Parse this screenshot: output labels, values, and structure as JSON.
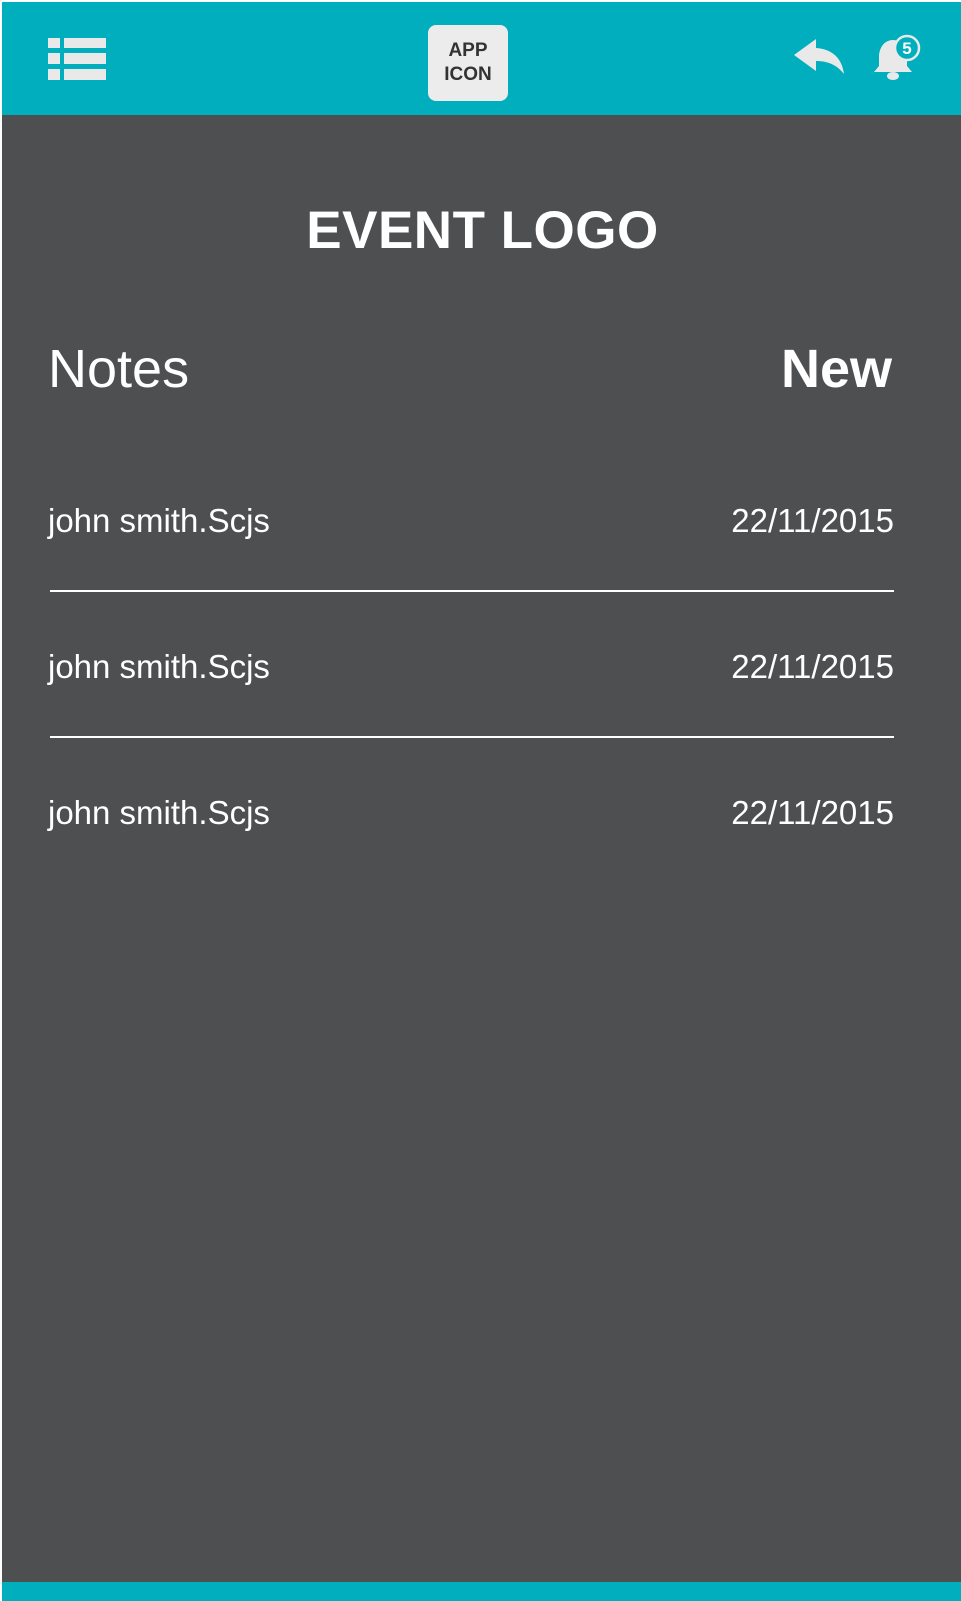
{
  "header": {
    "app_icon_line1": "APP",
    "app_icon_line2": "ICON",
    "notification_count": "5",
    "icons": {
      "menu": "list-menu-icon",
      "back": "reply-back-icon",
      "notifications": "bell-icon"
    }
  },
  "colors": {
    "accent": "#00aebd",
    "background": "#4e4f51",
    "text": "#ffffff"
  },
  "main": {
    "event_logo": "EVENT LOGO",
    "section_title": "Notes",
    "new_label": "New",
    "notes": [
      {
        "name": "john smith.Scjs",
        "date": "22/11/2015"
      },
      {
        "name": "john smith.Scjs",
        "date": "22/11/2015"
      },
      {
        "name": "john smith.Scjs",
        "date": "22/11/2015"
      }
    ]
  }
}
